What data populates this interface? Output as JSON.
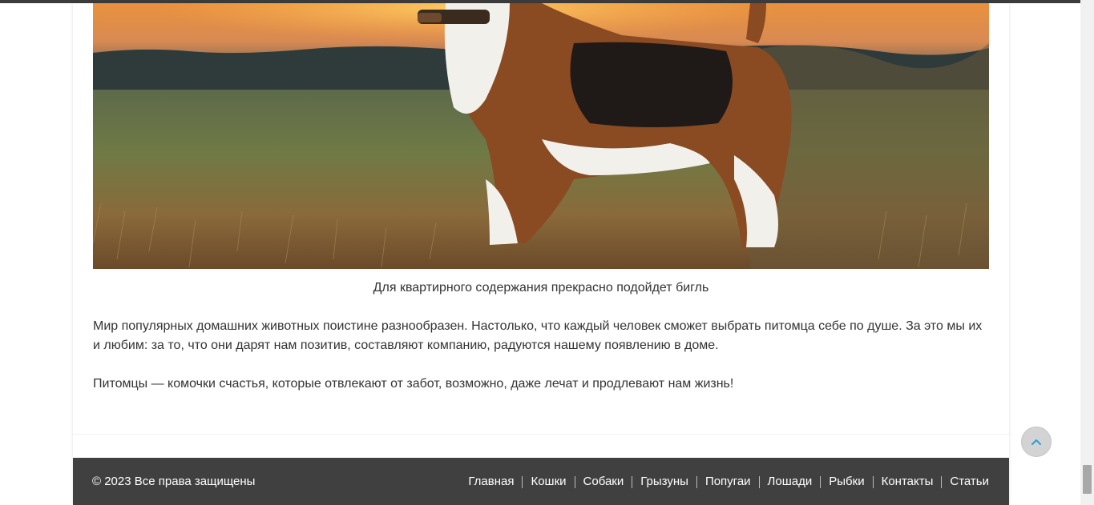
{
  "article": {
    "image_alt": "Бигль на поле на закате",
    "caption": "Для квартирного содержания прекрасно подойдет бигль",
    "paragraph1": "Мир популярных домашних животных поистине разнообразен. Настолько, что каждый человек сможет выбрать питомца себе по душе. За это мы их и любим: за то, что они дарят нам позитив, составляют компанию, радуются нашему появлению в доме.",
    "paragraph2": "Питомцы — комочки счастья, которые отвлекают от забот, возможно, даже лечат и продлевают нам жизнь!"
  },
  "footer": {
    "copyright": "© 2023 Все права защищены",
    "nav": [
      "Главная",
      "Кошки",
      "Собаки",
      "Грызуны",
      "Попугаи",
      "Лошади",
      "Рыбки",
      "Контакты",
      "Статьи"
    ]
  },
  "scroll_top": {
    "icon": "chevron-up-icon"
  },
  "colors": {
    "footer_bg": "#404040",
    "text": "#333333",
    "scroll_button_bg": "#d3d3d3",
    "scroll_icon": "#2a9fd6"
  }
}
